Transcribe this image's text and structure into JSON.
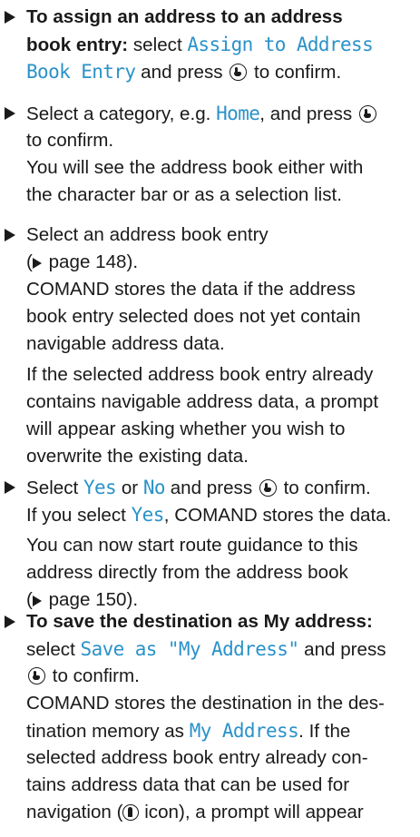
{
  "colors": {
    "ui_term": "#2a92c9",
    "text": "#1a1a1a"
  },
  "icons": {
    "controller": "push-controller-icon",
    "bullet": "triangle-bullet-icon",
    "page_ref": "triangle-outline-icon",
    "nav": "navigation-address-icon"
  },
  "steps": {
    "s1": {
      "l1": "To assign an address to an address",
      "l2_bold": "book entry:",
      "l2_a": " select ",
      "l2_ui": "Assign to Address",
      "l3_ui": "Book Entry",
      "l3_a": " and press ",
      "l3_b": " to confirm."
    },
    "s2": {
      "l1_a": "Select a category, e.g. ",
      "l1_ui": "Home",
      "l1_b": ", and press ",
      "l2": "to confirm.",
      "l3": "You will see the address book either with",
      "l4": "the character bar or as a selection list."
    },
    "s3": {
      "l1": "Select an address book entry",
      "l2": " page 148).",
      "l2_open": "(",
      "l3": "COMAND stores the data if the address",
      "l4": "book entry selected does not yet contain",
      "l5": "navigable address data.",
      "p1": "If the selected address book entry already",
      "p2": "contains navigable address data, a prompt",
      "p3": "will appear asking whether you wish to",
      "p4": "overwrite the existing data."
    },
    "s4": {
      "l1_a": "Select ",
      "l1_ui1": "Yes",
      "l1_b": " or ",
      "l1_ui2": "No",
      "l1_c": " and press ",
      "l1_d": " to confirm.",
      "l2_a": "If you select ",
      "l2_ui": "Yes",
      "l2_b": ", COMAND stores the data.",
      "p1": "You can now start route guidance to this",
      "p2": "address directly from the address book",
      "p3_open": "(",
      "p3": " page 150)."
    },
    "s5": {
      "l1": "To save the destination as My address:",
      "l2_a": "select ",
      "l2_ui": "Save as \"My Address\"",
      "l2_b": " and press",
      "l3": " to confirm.",
      "l4": "COMAND stores the destination in the des-",
      "l5_a": "tination memory as ",
      "l5_ui": "My Address",
      "l5_b": ". If the",
      "l6": "selected address book entry already con-",
      "l7": "tains address data that can be used for",
      "l8_a": "navigation (",
      "l8_b": " icon), a prompt will appear"
    }
  }
}
